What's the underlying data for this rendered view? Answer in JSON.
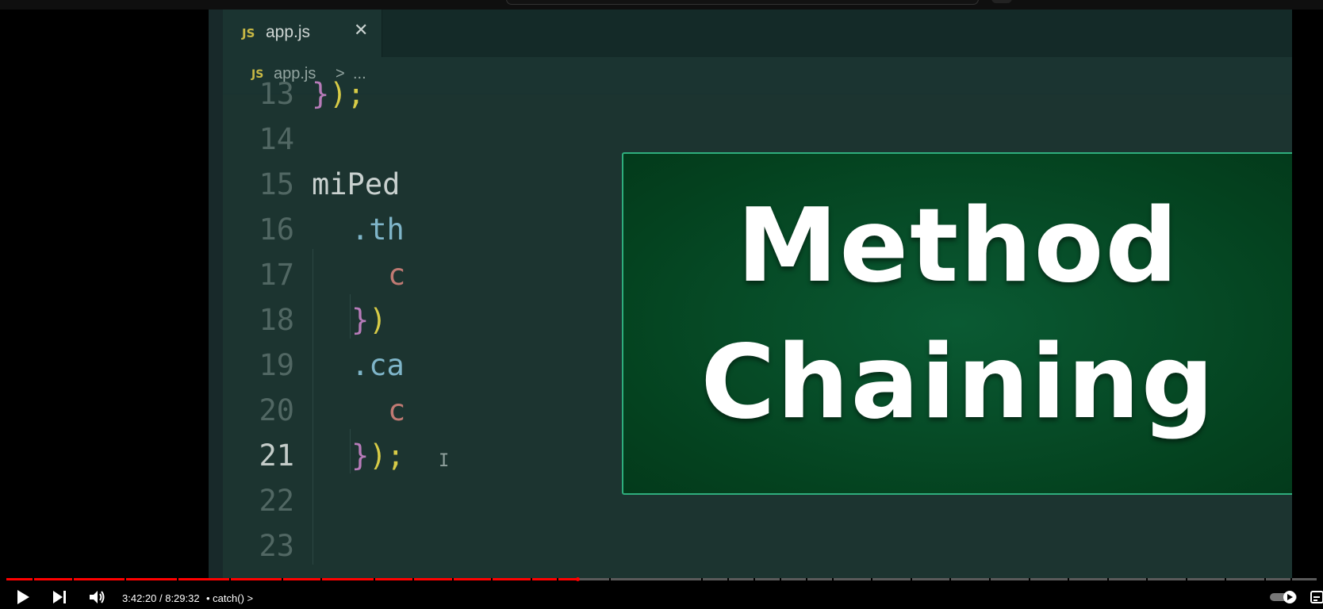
{
  "editor": {
    "tab": {
      "icon_text": "JS",
      "filename": "app.js",
      "close": "✕"
    },
    "breadcrumb": {
      "icon_text": "JS",
      "filename": "app.js",
      "separator": ">",
      "more": "..."
    },
    "lines": [
      {
        "n": "13",
        "t": "});"
      },
      {
        "n": "14",
        "t": ""
      },
      {
        "n": "15",
        "t": "miPed"
      },
      {
        "n": "16",
        "t": ".th"
      },
      {
        "n": "17",
        "t": "c"
      },
      {
        "n": "18",
        "t": "})"
      },
      {
        "n": "19",
        "t": ".ca"
      },
      {
        "n": "20",
        "t": "c"
      },
      {
        "n": "21",
        "t": "});"
      },
      {
        "n": "22",
        "t": ""
      },
      {
        "n": "23",
        "t": ""
      }
    ],
    "current_line": "21"
  },
  "overlay": {
    "line1": "Method",
    "line2": "Chaining"
  },
  "player": {
    "time": "3:42:20 / 8:29:32",
    "chapter": "• catch()",
    "chapter_chevron": ">",
    "progress_fraction": 0.436,
    "accent": "#ff0000"
  },
  "colors": {
    "bg": "#1c3430",
    "overlay_green": "#04421f",
    "keyword_purple": "#b77bb9",
    "bracket_yellow": "#d7cb47"
  },
  "icons": {
    "play": "play-icon",
    "next": "next-icon",
    "volume": "volume-icon",
    "autoplay": "autoplay-toggle-icon",
    "subtitles": "subtitles-icon"
  }
}
